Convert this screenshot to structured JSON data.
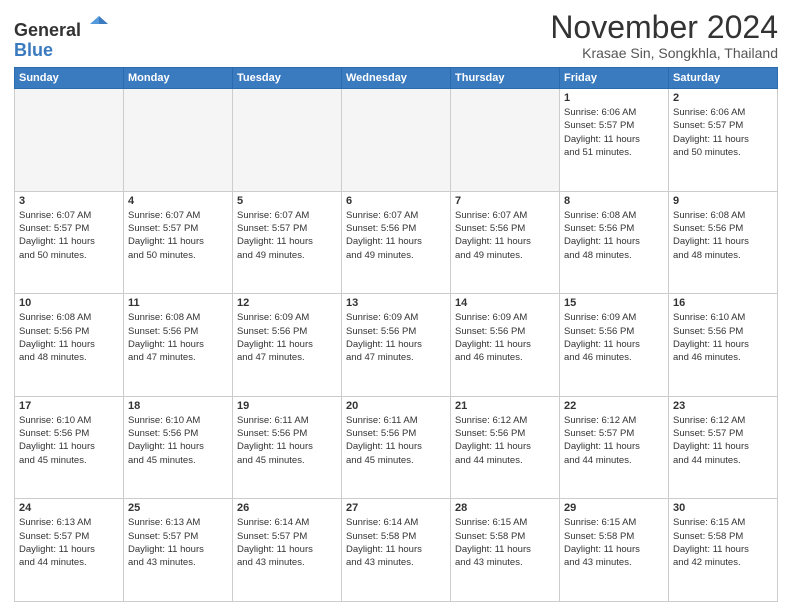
{
  "header": {
    "logo_general": "General",
    "logo_blue": "Blue",
    "month_title": "November 2024",
    "location": "Krasae Sin, Songkhla, Thailand"
  },
  "weekdays": [
    "Sunday",
    "Monday",
    "Tuesday",
    "Wednesday",
    "Thursday",
    "Friday",
    "Saturday"
  ],
  "weeks": [
    [
      {
        "day": "",
        "info": ""
      },
      {
        "day": "",
        "info": ""
      },
      {
        "day": "",
        "info": ""
      },
      {
        "day": "",
        "info": ""
      },
      {
        "day": "",
        "info": ""
      },
      {
        "day": "1",
        "info": "Sunrise: 6:06 AM\nSunset: 5:57 PM\nDaylight: 11 hours\nand 51 minutes."
      },
      {
        "day": "2",
        "info": "Sunrise: 6:06 AM\nSunset: 5:57 PM\nDaylight: 11 hours\nand 50 minutes."
      }
    ],
    [
      {
        "day": "3",
        "info": "Sunrise: 6:07 AM\nSunset: 5:57 PM\nDaylight: 11 hours\nand 50 minutes."
      },
      {
        "day": "4",
        "info": "Sunrise: 6:07 AM\nSunset: 5:57 PM\nDaylight: 11 hours\nand 50 minutes."
      },
      {
        "day": "5",
        "info": "Sunrise: 6:07 AM\nSunset: 5:57 PM\nDaylight: 11 hours\nand 49 minutes."
      },
      {
        "day": "6",
        "info": "Sunrise: 6:07 AM\nSunset: 5:56 PM\nDaylight: 11 hours\nand 49 minutes."
      },
      {
        "day": "7",
        "info": "Sunrise: 6:07 AM\nSunset: 5:56 PM\nDaylight: 11 hours\nand 49 minutes."
      },
      {
        "day": "8",
        "info": "Sunrise: 6:08 AM\nSunset: 5:56 PM\nDaylight: 11 hours\nand 48 minutes."
      },
      {
        "day": "9",
        "info": "Sunrise: 6:08 AM\nSunset: 5:56 PM\nDaylight: 11 hours\nand 48 minutes."
      }
    ],
    [
      {
        "day": "10",
        "info": "Sunrise: 6:08 AM\nSunset: 5:56 PM\nDaylight: 11 hours\nand 48 minutes."
      },
      {
        "day": "11",
        "info": "Sunrise: 6:08 AM\nSunset: 5:56 PM\nDaylight: 11 hours\nand 47 minutes."
      },
      {
        "day": "12",
        "info": "Sunrise: 6:09 AM\nSunset: 5:56 PM\nDaylight: 11 hours\nand 47 minutes."
      },
      {
        "day": "13",
        "info": "Sunrise: 6:09 AM\nSunset: 5:56 PM\nDaylight: 11 hours\nand 47 minutes."
      },
      {
        "day": "14",
        "info": "Sunrise: 6:09 AM\nSunset: 5:56 PM\nDaylight: 11 hours\nand 46 minutes."
      },
      {
        "day": "15",
        "info": "Sunrise: 6:09 AM\nSunset: 5:56 PM\nDaylight: 11 hours\nand 46 minutes."
      },
      {
        "day": "16",
        "info": "Sunrise: 6:10 AM\nSunset: 5:56 PM\nDaylight: 11 hours\nand 46 minutes."
      }
    ],
    [
      {
        "day": "17",
        "info": "Sunrise: 6:10 AM\nSunset: 5:56 PM\nDaylight: 11 hours\nand 45 minutes."
      },
      {
        "day": "18",
        "info": "Sunrise: 6:10 AM\nSunset: 5:56 PM\nDaylight: 11 hours\nand 45 minutes."
      },
      {
        "day": "19",
        "info": "Sunrise: 6:11 AM\nSunset: 5:56 PM\nDaylight: 11 hours\nand 45 minutes."
      },
      {
        "day": "20",
        "info": "Sunrise: 6:11 AM\nSunset: 5:56 PM\nDaylight: 11 hours\nand 45 minutes."
      },
      {
        "day": "21",
        "info": "Sunrise: 6:12 AM\nSunset: 5:56 PM\nDaylight: 11 hours\nand 44 minutes."
      },
      {
        "day": "22",
        "info": "Sunrise: 6:12 AM\nSunset: 5:57 PM\nDaylight: 11 hours\nand 44 minutes."
      },
      {
        "day": "23",
        "info": "Sunrise: 6:12 AM\nSunset: 5:57 PM\nDaylight: 11 hours\nand 44 minutes."
      }
    ],
    [
      {
        "day": "24",
        "info": "Sunrise: 6:13 AM\nSunset: 5:57 PM\nDaylight: 11 hours\nand 44 minutes."
      },
      {
        "day": "25",
        "info": "Sunrise: 6:13 AM\nSunset: 5:57 PM\nDaylight: 11 hours\nand 43 minutes."
      },
      {
        "day": "26",
        "info": "Sunrise: 6:14 AM\nSunset: 5:57 PM\nDaylight: 11 hours\nand 43 minutes."
      },
      {
        "day": "27",
        "info": "Sunrise: 6:14 AM\nSunset: 5:58 PM\nDaylight: 11 hours\nand 43 minutes."
      },
      {
        "day": "28",
        "info": "Sunrise: 6:15 AM\nSunset: 5:58 PM\nDaylight: 11 hours\nand 43 minutes."
      },
      {
        "day": "29",
        "info": "Sunrise: 6:15 AM\nSunset: 5:58 PM\nDaylight: 11 hours\nand 43 minutes."
      },
      {
        "day": "30",
        "info": "Sunrise: 6:15 AM\nSunset: 5:58 PM\nDaylight: 11 hours\nand 42 minutes."
      }
    ]
  ]
}
